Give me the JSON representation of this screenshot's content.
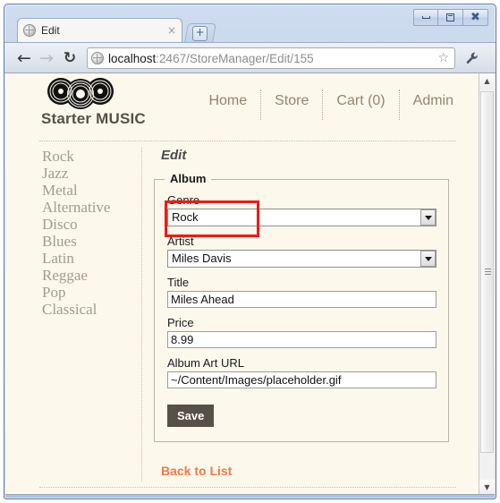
{
  "window": {
    "controls": {
      "minimize": "minimize-button",
      "maximize": "maximize-button",
      "close": "close-button"
    }
  },
  "browser": {
    "tab": {
      "title": "Edit",
      "close_label": "×",
      "favicon": "globe-icon"
    },
    "new_tab_label": "+",
    "toolbar": {
      "back": "←",
      "forward": "→",
      "reload": "C",
      "bookmark_star": "☆",
      "menu_wrench": "🔧"
    },
    "omnibox": {
      "host": "localhost",
      "path": ":2467/StoreManager/Edit/155",
      "full_url": "localhost:2467/StoreManager/Edit/155"
    }
  },
  "site": {
    "title": "Starter MUSIC",
    "logo": "vinyl-records-logo",
    "nav": [
      {
        "label": "Home"
      },
      {
        "label": "Store"
      },
      {
        "label": "Cart (0)"
      },
      {
        "label": "Admin"
      }
    ]
  },
  "sidebar": {
    "genres": [
      "Rock",
      "Jazz",
      "Metal",
      "Alternative",
      "Disco",
      "Blues",
      "Latin",
      "Reggae",
      "Pop",
      "Classical"
    ]
  },
  "main": {
    "page_title": "Edit",
    "fieldset_legend": "Album",
    "fields": {
      "genre": {
        "label": "Genre",
        "value": "Rock",
        "type": "select"
      },
      "artist": {
        "label": "Artist",
        "value": "Miles Davis",
        "type": "select"
      },
      "title": {
        "label": "Title",
        "value": "Miles Ahead",
        "type": "text"
      },
      "price": {
        "label": "Price",
        "value": "8.99",
        "type": "text"
      },
      "album_art_url": {
        "label": "Album Art URL",
        "value": "~/Content/Images/placeholder.gif",
        "type": "text"
      }
    },
    "save_label": "Save",
    "back_link_label": "Back to List"
  },
  "annotation": {
    "color": "#ee1b15",
    "target": "genre-field"
  },
  "colors": {
    "page_background": "#fdf8ec",
    "nav_text": "#93856f",
    "genre_text": "#a39c8f",
    "link_orange": "#f0784a",
    "save_button": "#565047",
    "annotation_red": "#ee1b15"
  },
  "scrollbar": {
    "up_arrow": "▲",
    "down_arrow": "▼"
  }
}
